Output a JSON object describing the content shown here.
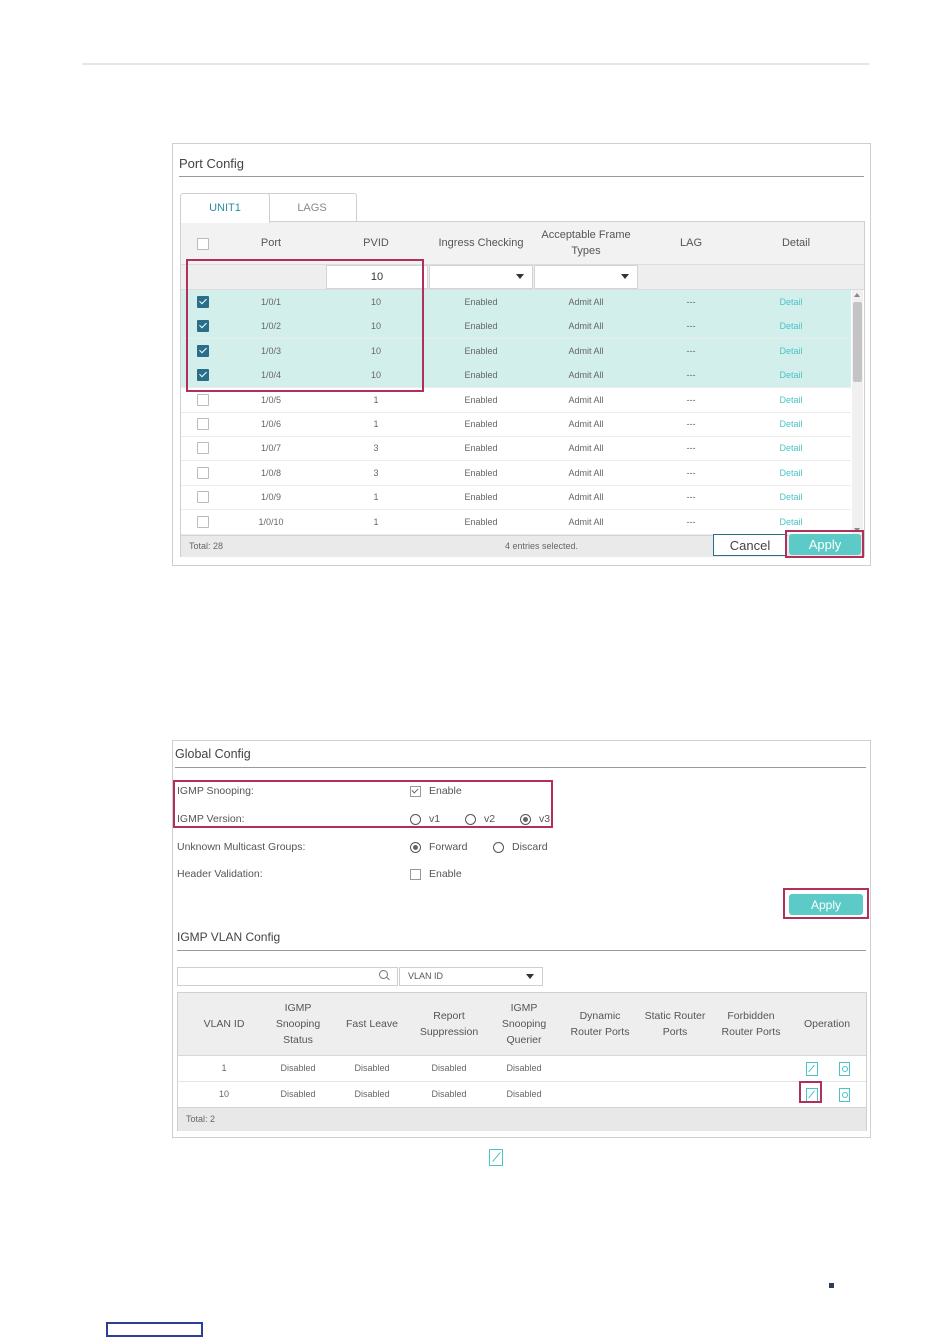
{
  "port_config": {
    "title": "Port Config",
    "tabs": [
      "UNIT1",
      "LAGS"
    ],
    "columns": {
      "port": "Port",
      "pvid": "PVID",
      "ingress": "Ingress Checking",
      "frame_types": "Acceptable Frame Types",
      "lag": "LAG",
      "detail": "Detail"
    },
    "filter": {
      "pvid_value": "10",
      "ingress_value": "",
      "frame_value": ""
    },
    "rows": [
      {
        "port": "1/0/1",
        "pvid": "10",
        "ingress": "Enabled",
        "frame": "Admit All",
        "lag": "---",
        "detail": "Detail",
        "selected": true
      },
      {
        "port": "1/0/2",
        "pvid": "10",
        "ingress": "Enabled",
        "frame": "Admit All",
        "lag": "---",
        "detail": "Detail",
        "selected": true
      },
      {
        "port": "1/0/3",
        "pvid": "10",
        "ingress": "Enabled",
        "frame": "Admit All",
        "lag": "---",
        "detail": "Detail",
        "selected": true
      },
      {
        "port": "1/0/4",
        "pvid": "10",
        "ingress": "Enabled",
        "frame": "Admit All",
        "lag": "---",
        "detail": "Detail",
        "selected": true
      },
      {
        "port": "1/0/5",
        "pvid": "1",
        "ingress": "Enabled",
        "frame": "Admit All",
        "lag": "---",
        "detail": "Detail",
        "selected": false
      },
      {
        "port": "1/0/6",
        "pvid": "1",
        "ingress": "Enabled",
        "frame": "Admit All",
        "lag": "---",
        "detail": "Detail",
        "selected": false
      },
      {
        "port": "1/0/7",
        "pvid": "3",
        "ingress": "Enabled",
        "frame": "Admit All",
        "lag": "---",
        "detail": "Detail",
        "selected": false
      },
      {
        "port": "1/0/8",
        "pvid": "3",
        "ingress": "Enabled",
        "frame": "Admit All",
        "lag": "---",
        "detail": "Detail",
        "selected": false
      },
      {
        "port": "1/0/9",
        "pvid": "1",
        "ingress": "Enabled",
        "frame": "Admit All",
        "lag": "---",
        "detail": "Detail",
        "selected": false
      },
      {
        "port": "1/0/10",
        "pvid": "1",
        "ingress": "Enabled",
        "frame": "Admit All",
        "lag": "---",
        "detail": "Detail",
        "selected": false
      }
    ],
    "footer": {
      "total": "Total: 28",
      "selected": "4 entries selected."
    },
    "cancel_label": "Cancel",
    "apply_label": "Apply"
  },
  "global_config": {
    "title": "Global Config",
    "igmp_snooping_label": "IGMP Snooping:",
    "igmp_snooping_option": "Enable",
    "igmp_version_label": "IGMP Version:",
    "version_options": [
      "v1",
      "v2",
      "v3"
    ],
    "unknown_mc_label": "Unknown Multicast Groups:",
    "unknown_mc_options": [
      "Forward",
      "Discard"
    ],
    "header_validation_label": "Header Validation:",
    "header_validation_option": "Enable",
    "apply_label": "Apply",
    "vlan_section_title": "IGMP VLAN Config",
    "search_placeholder": "",
    "select_value": "VLAN ID",
    "columns": {
      "vlan_id": "VLAN ID",
      "snooping_status": "IGMP Snooping Status",
      "fast_leave": "Fast Leave",
      "report_suppression": "Report Suppression",
      "snooping_querier": "IGMP Snooping Querier",
      "dynamic_router": "Dynamic Router Ports",
      "static_router": "Static Router Ports",
      "forbidden_router": "Forbidden Router Ports",
      "operation": "Operation"
    },
    "rows": [
      {
        "vlan_id": "1",
        "status": "Disabled",
        "fast_leave": "Disabled",
        "report": "Disabled",
        "querier": "Disabled"
      },
      {
        "vlan_id": "10",
        "status": "Disabled",
        "fast_leave": "Disabled",
        "report": "Disabled",
        "querier": "Disabled"
      }
    ],
    "total": "Total: 2"
  },
  "colors": {
    "accent": "#5ccbc8",
    "highlight": "#b0305c",
    "selected_row": "#d3efec",
    "link": "#4cc3c6"
  }
}
